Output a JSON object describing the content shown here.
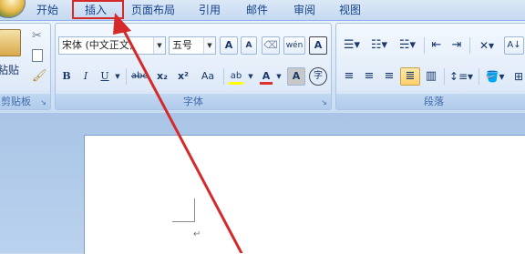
{
  "tabs": [
    "开始",
    "插入",
    "页面布局",
    "引用",
    "邮件",
    "审阅",
    "视图"
  ],
  "clipboard": {
    "paste_label": "粘贴",
    "group_label": "剪贴板"
  },
  "font": {
    "font_name": "宋体 (中文正文)",
    "font_size": "五号",
    "group_label": "字体",
    "btn_grow": "A",
    "btn_shrink": "A",
    "btn_phonetic": "wén",
    "btn_border_char": "A",
    "btn_bold": "B",
    "btn_italic": "I",
    "btn_underline": "U",
    "btn_strike": "abc",
    "btn_subscript": "x₂",
    "btn_superscript": "x²",
    "btn_case": "Aa",
    "btn_highlight": "ab",
    "btn_font_color": "A",
    "btn_shading": "A",
    "btn_enclose": "字",
    "highlight_color": "#ffff00",
    "font_color": "#e03030"
  },
  "paragraph": {
    "group_label": "段落"
  },
  "annotation": {
    "color": "#d42a2a"
  }
}
